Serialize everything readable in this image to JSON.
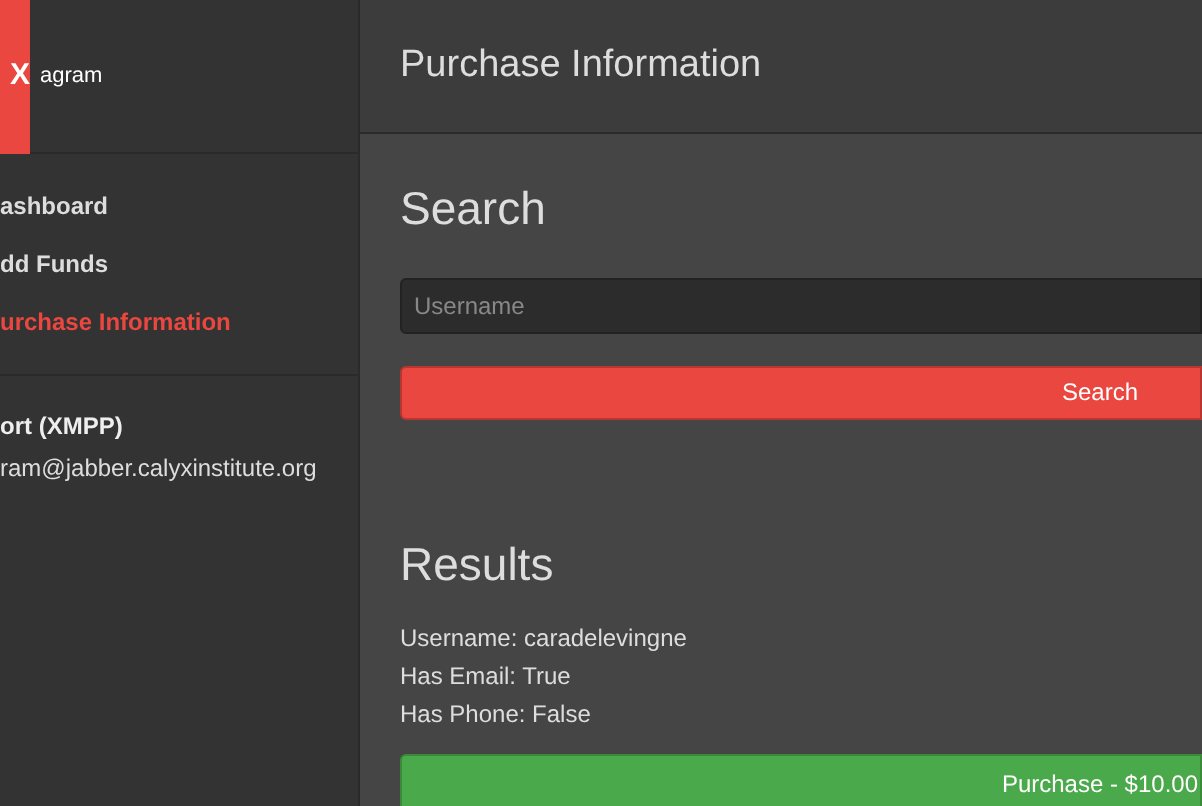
{
  "brand": {
    "logo": "X",
    "name": "agram"
  },
  "nav": [
    {
      "label": "ashboard",
      "selected": false
    },
    {
      "label": "dd Funds",
      "selected": false
    },
    {
      "label": "urchase Information",
      "selected": true
    }
  ],
  "support": {
    "title": "ort (XMPP)",
    "address": "ram@jabber.calyxinstitute.org"
  },
  "header": {
    "title": "Purchase Information"
  },
  "search": {
    "heading": "Search",
    "placeholder": "Username",
    "button": "Search"
  },
  "results": {
    "heading": "Results",
    "lines": [
      "Username: caradelevingne",
      "Has Email: True",
      "Has Phone: False"
    ],
    "button": "Purchase - $10.00"
  }
}
